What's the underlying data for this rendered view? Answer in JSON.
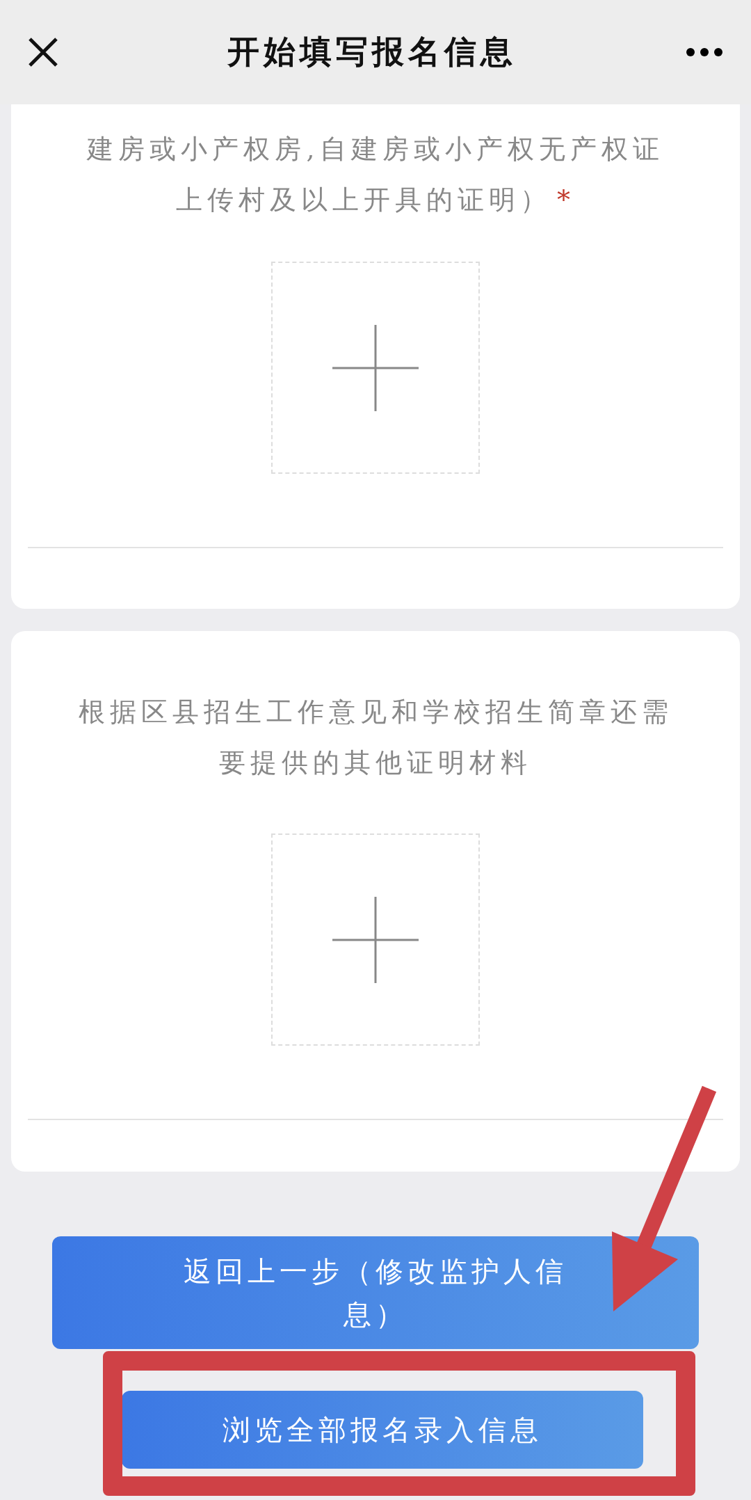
{
  "header": {
    "title": "开始填写报名信息"
  },
  "cards": [
    {
      "lines": [
        "建房或小产权房,自建房或小产权无产权证",
        "上传村及以上开具的证明）"
      ],
      "required_mark": "*"
    },
    {
      "lines": [
        "根据区县招生工作意见和学校招生简章还需",
        "要提供的其他证明材料"
      ]
    }
  ],
  "buttons": [
    {
      "lines": [
        "返回上一步（修改监护人信",
        "息）"
      ],
      "highlighted": false
    },
    {
      "lines": [
        "浏览全部报名录入信息"
      ],
      "highlighted": true
    }
  ]
}
